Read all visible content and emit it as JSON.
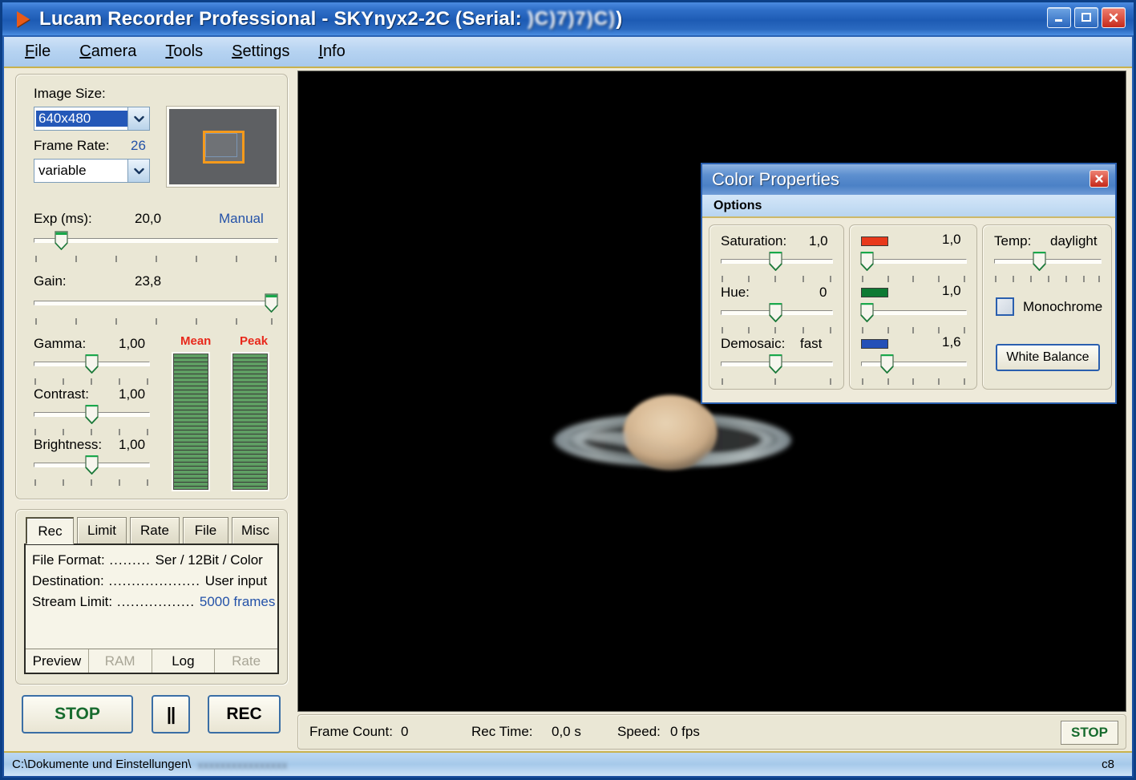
{
  "window": {
    "title_prefix": "Lucam Recorder Professional - SKYnyx2-2C (Serial:",
    "title_serial": ")C)7)7)C)",
    "title_suffix": ")",
    "minimize_icon": "minimize-icon",
    "maximize_icon": "maximize-icon",
    "close_icon": "close-icon"
  },
  "menubar": {
    "items": [
      {
        "label": "File",
        "accel": "F"
      },
      {
        "label": "Camera",
        "accel": "C"
      },
      {
        "label": "Tools",
        "accel": "T"
      },
      {
        "label": "Settings",
        "accel": "S"
      },
      {
        "label": "Info",
        "accel": "I"
      }
    ]
  },
  "camera_panel": {
    "image_size_label": "Image Size:",
    "image_size_value": "640x480",
    "frame_rate_label": "Frame Rate:",
    "frame_rate_value": "26",
    "frame_rate_mode": "variable",
    "exposure_label": "Exp (ms):",
    "exposure_value": "20,0",
    "exposure_mode": "Manual",
    "gain_label": "Gain:",
    "gain_value": "23,8",
    "gamma_label": "Gamma:",
    "gamma_value": "1,00",
    "contrast_label": "Contrast:",
    "contrast_value": "1,00",
    "brightness_label": "Brightness:",
    "brightness_value": "1,00",
    "mean_label": "Mean",
    "peak_label": "Peak",
    "meter_colors": {
      "bar": "#5f9e63",
      "label": "#e8281b"
    }
  },
  "rec_panel": {
    "tabs": [
      {
        "label": "Rec",
        "active": true
      },
      {
        "label": "Limit",
        "active": false
      },
      {
        "label": "Rate",
        "active": false
      },
      {
        "label": "File",
        "active": false
      },
      {
        "label": "Misc",
        "active": false
      }
    ],
    "info": [
      {
        "label": "File Format:",
        "dots": " ......... ",
        "value": "Ser / 12Bit / Color",
        "highlight": false
      },
      {
        "label": "Destination:",
        "dots": " .................... ",
        "value": "User input",
        "highlight": false
      },
      {
        "label": "Stream Limit:",
        "dots": " ................. ",
        "value": "5000 frames",
        "highlight": true
      }
    ],
    "bottom_buttons": [
      {
        "label": "Preview",
        "disabled": false
      },
      {
        "label": "RAM",
        "disabled": true
      },
      {
        "label": "Log",
        "disabled": false
      },
      {
        "label": "Rate",
        "disabled": true
      }
    ]
  },
  "transport": {
    "stop_label": "STOP",
    "pause_label": "||",
    "rec_label": "REC",
    "stop_color": "#176b2e"
  },
  "video_status": {
    "frame_count_label": "Frame Count:",
    "frame_count_value": "0",
    "rec_time_label": "Rec Time:",
    "rec_time_value": "0,0 s",
    "speed_label": "Speed:",
    "speed_value": "0 fps",
    "stop_label": "STOP"
  },
  "statusbar": {
    "path": "C:\\Dokumente und Einstellungen\\",
    "path_blurred": "xxxxxxxxxxxxxxxx",
    "right_indicator": "c8"
  },
  "color_dialog": {
    "title": "Color Properties",
    "menu": "Options",
    "close_icon": "close-icon",
    "saturation_label": "Saturation:",
    "saturation_value": "1,0",
    "hue_label": "Hue:",
    "hue_value": "0",
    "demosaic_label": "Demosaic:",
    "demosaic_value": "fast",
    "red_swatch": "#e8391b",
    "red_value": "1,0",
    "green_swatch": "#0e7a33",
    "green_value": "1,0",
    "blue_swatch": "#2450b8",
    "blue_value": "1,6",
    "temp_label": "Temp:",
    "temp_value": "daylight",
    "monochrome_label": "Monochrome",
    "monochrome_checked": false,
    "white_balance_label": "White Balance"
  },
  "preview": {
    "roi_color": "#f59a1b",
    "background": "#5e6063"
  }
}
